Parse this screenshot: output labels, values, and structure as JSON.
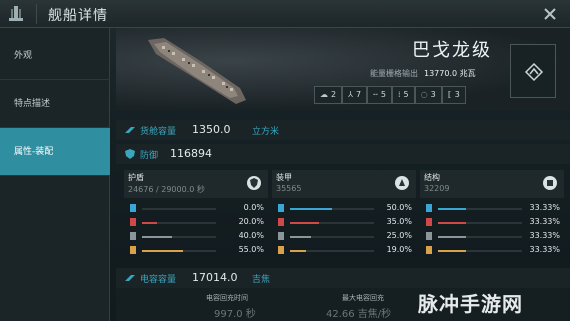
{
  "window": {
    "title": "舰船详情"
  },
  "sidebar": {
    "items": [
      {
        "label": "外观",
        "active": false
      },
      {
        "label": "特点描述",
        "active": false
      },
      {
        "label": "属性-装配",
        "active": true
      }
    ]
  },
  "ship": {
    "name": "巴戈龙级",
    "power_label": "能量栅格输出",
    "power_value": "13770.0 兆瓦",
    "slots": [
      {
        "icon": "cloud-icon",
        "glyph": "☁",
        "value": "2"
      },
      {
        "icon": "turret-icon",
        "glyph": "⅄",
        "value": "7"
      },
      {
        "icon": "dash-icon",
        "glyph": "╌",
        "value": "5"
      },
      {
        "icon": "bracket-icon",
        "glyph": "⁞",
        "value": "5"
      },
      {
        "icon": "ring-icon",
        "glyph": "◌",
        "value": "3"
      },
      {
        "icon": "frame-icon",
        "glyph": "⟦",
        "value": "3"
      }
    ]
  },
  "cargo": {
    "label": "货舱容量",
    "value": "1350.0",
    "unit": "立方米"
  },
  "defense": {
    "label": "防御",
    "value": "116894"
  },
  "columns": [
    {
      "name": "护盾",
      "hp": "24676 / 29000.0 秒",
      "icon": "shield-icon",
      "resists": [
        {
          "pct": "0.0%",
          "fraction": 0.0,
          "color": "#3aa6d6"
        },
        {
          "pct": "20.0%",
          "fraction": 0.2,
          "color": "#d04848"
        },
        {
          "pct": "40.0%",
          "fraction": 0.4,
          "color": "#8a9699"
        },
        {
          "pct": "55.0%",
          "fraction": 0.55,
          "color": "#d9a24a"
        }
      ]
    },
    {
      "name": "装甲",
      "hp": "35565",
      "icon": "armor-icon",
      "resists": [
        {
          "pct": "50.0%",
          "fraction": 0.5,
          "color": "#3aa6d6"
        },
        {
          "pct": "35.0%",
          "fraction": 0.35,
          "color": "#d04848"
        },
        {
          "pct": "25.0%",
          "fraction": 0.25,
          "color": "#8a9699"
        },
        {
          "pct": "19.0%",
          "fraction": 0.19,
          "color": "#d9a24a"
        }
      ]
    },
    {
      "name": "结构",
      "hp": "32209",
      "icon": "structure-icon",
      "resists": [
        {
          "pct": "33.33%",
          "fraction": 0.3333,
          "color": "#3aa6d6"
        },
        {
          "pct": "33.33%",
          "fraction": 0.3333,
          "color": "#d04848"
        },
        {
          "pct": "33.33%",
          "fraction": 0.3333,
          "color": "#8a9699"
        },
        {
          "pct": "33.33%",
          "fraction": 0.3333,
          "color": "#d9a24a"
        }
      ]
    }
  ],
  "capacitor": {
    "label": "电容容量",
    "value": "17014.0",
    "unit": "吉焦"
  },
  "bottom": {
    "recharge_label": "电容回充时间",
    "recharge_value": "997.0 秒",
    "peak_label": "最大电容回充",
    "peak_value": "42.66 吉焦/秒"
  },
  "watermark": "脉冲手游网",
  "colors": {
    "accent": "#2f8fa0",
    "label": "#3aa6bd"
  }
}
